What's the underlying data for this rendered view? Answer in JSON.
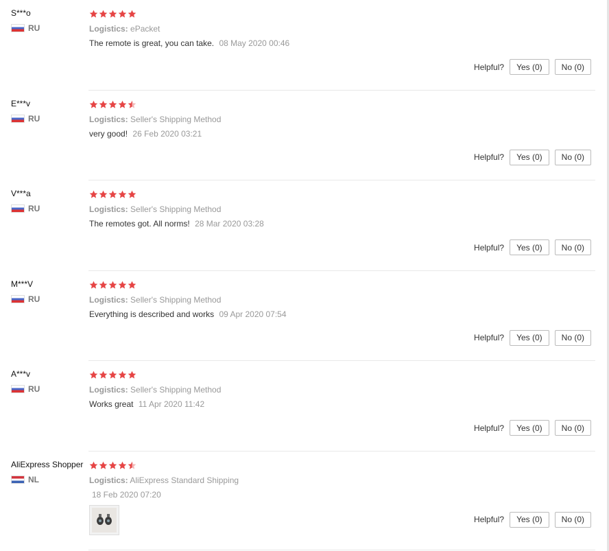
{
  "helpful_label": "Helpful?",
  "logistics_label": "Logistics:",
  "colors": {
    "star": "#e64545",
    "accent": "#e64545"
  },
  "reviews": [
    {
      "user": "S***o",
      "country": "RU",
      "flag": "ru",
      "rating": 5,
      "logistics": "ePacket",
      "text": "The remote is great, you can take.",
      "date": "08 May 2020 00:46",
      "yes": "Yes (0)",
      "no": "No (0)"
    },
    {
      "user": "E***v",
      "country": "RU",
      "flag": "ru",
      "rating": 4.5,
      "logistics": "Seller's Shipping Method",
      "text": "very good!",
      "date": "26 Feb 2020 03:21",
      "yes": "Yes (0)",
      "no": "No (0)"
    },
    {
      "user": "V***a",
      "country": "RU",
      "flag": "ru",
      "rating": 5,
      "logistics": "Seller's Shipping Method",
      "text": "The remotes got. All norms!",
      "date": "28 Mar 2020 03:28",
      "yes": "Yes (0)",
      "no": "No (0)"
    },
    {
      "user": "M***V",
      "country": "RU",
      "flag": "ru",
      "rating": 5,
      "logistics": "Seller's Shipping Method",
      "text": "Everything is described and works",
      "date": "09 Apr 2020 07:54",
      "yes": "Yes (0)",
      "no": "No (0)"
    },
    {
      "user": "A***v",
      "country": "RU",
      "flag": "ru",
      "rating": 5,
      "logistics": "Seller's Shipping Method",
      "text": "Works great",
      "date": "11 Apr 2020 11:42",
      "yes": "Yes (0)",
      "no": "No (0)"
    },
    {
      "user": "AliExpress Shopper",
      "country": "NL",
      "flag": "nl",
      "rating": 4.5,
      "logistics": "AliExpress Standard Shipping",
      "text": "",
      "date": "18 Feb 2020 07:20",
      "photo_icon": "product-photo-icon",
      "yes": "Yes (0)",
      "no": "No (0)"
    }
  ]
}
